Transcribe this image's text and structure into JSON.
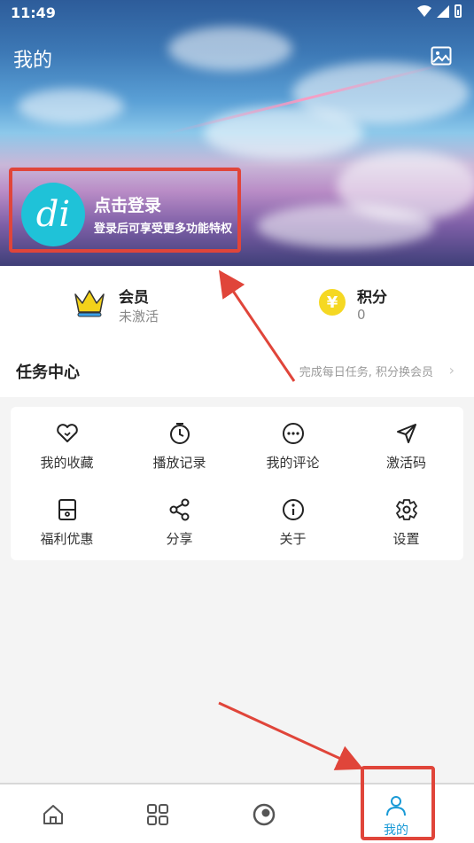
{
  "status_bar": {
    "time": "11:49"
  },
  "header": {
    "title": "我的",
    "gallery_icon": "image-icon",
    "avatar_text": "di",
    "login_title": "点击登录",
    "login_subtitle": "登录后可享受更多功能特权"
  },
  "stats": {
    "vip": {
      "label": "会员",
      "value": "未激活",
      "icon": "crown-icon"
    },
    "points": {
      "label": "积分",
      "value": "0",
      "icon": "yuan-coin-icon",
      "symbol": "¥"
    }
  },
  "task_center": {
    "title": "任务中心",
    "hint": "完成每日任务, 积分换会员",
    "chevron": "›"
  },
  "grid": [
    {
      "label": "我的收藏",
      "icon": "heart-icon"
    },
    {
      "label": "播放记录",
      "icon": "timer-icon"
    },
    {
      "label": "我的评论",
      "icon": "comment-icon"
    },
    {
      "label": "激活码",
      "icon": "send-icon"
    },
    {
      "label": "福利优惠",
      "icon": "wallet-icon"
    },
    {
      "label": "分享",
      "icon": "share-icon"
    },
    {
      "label": "关于",
      "icon": "info-icon"
    },
    {
      "label": "设置",
      "icon": "gear-icon"
    }
  ],
  "bottom_nav": [
    {
      "label": "",
      "icon": "home-icon",
      "active": false
    },
    {
      "label": "",
      "icon": "grid-icon",
      "active": false
    },
    {
      "label": "",
      "icon": "discover-icon",
      "active": false
    },
    {
      "label": "我的",
      "icon": "user-icon",
      "active": true
    }
  ],
  "colors": {
    "accent": "#1a9ad6",
    "annotation": "#e0453a",
    "avatar": "#1fc2d8",
    "coin": "#f5d823",
    "crown": "#f3d21a"
  }
}
